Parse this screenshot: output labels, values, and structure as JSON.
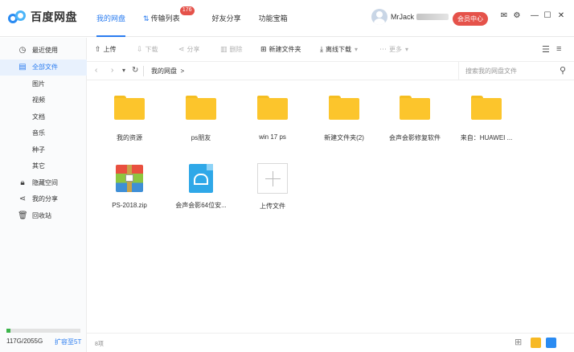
{
  "app": {
    "logo_text": "百度网盘"
  },
  "nav": {
    "tabs": [
      {
        "label": "我的网盘"
      },
      {
        "label": "传输列表",
        "badge": "176"
      },
      {
        "label": "好友分享"
      },
      {
        "label": "功能宝箱"
      }
    ]
  },
  "user": {
    "name": "MrJack",
    "vip_button": "会员中心"
  },
  "sidebar": {
    "items": [
      {
        "label": "最近使用",
        "icon": "clock-icon"
      },
      {
        "label": "全部文件",
        "icon": "file-icon"
      },
      {
        "label": "图片"
      },
      {
        "label": "视频"
      },
      {
        "label": "文档"
      },
      {
        "label": "音乐"
      },
      {
        "label": "种子"
      },
      {
        "label": "其它"
      },
      {
        "label": "隐藏空间",
        "icon": "lock-icon"
      },
      {
        "label": "我的分享",
        "icon": "share-icon"
      },
      {
        "label": "回收站",
        "icon": "trash-icon"
      }
    ],
    "quota_text": "117G/2055G",
    "quota_fraction": 0.057,
    "expand_label": "扩容至5T"
  },
  "toolbar": {
    "upload": "上传",
    "download": "下载",
    "share": "分享",
    "delete": "删除",
    "new_folder": "新建文件夹",
    "offline": "离线下载",
    "more": "更多"
  },
  "address": {
    "crumb": "我的网盘",
    "crumb_arrow": ">",
    "search_placeholder": "搜索我的网盘文件"
  },
  "files": [
    {
      "name": "我的资源",
      "type": "folder"
    },
    {
      "name": "ps朋友",
      "type": "folder"
    },
    {
      "name": "win 17 ps",
      "type": "folder"
    },
    {
      "name": "新建文件夹(2)",
      "type": "folder"
    },
    {
      "name": "会声会影修复软件",
      "type": "folder"
    },
    {
      "name": "来自：HUAWEI ...",
      "type": "folder"
    },
    {
      "name": "PS-2018.zip",
      "type": "zip"
    },
    {
      "name": "会声会影64位安...",
      "type": "apk"
    },
    {
      "name": "上传文件",
      "type": "upload"
    }
  ],
  "status": {
    "count": "8项"
  },
  "colors": {
    "accent": "#2a7cf0",
    "vip": "#e5524a",
    "folder": "#fcc52c",
    "quota": "#3bb44a"
  }
}
